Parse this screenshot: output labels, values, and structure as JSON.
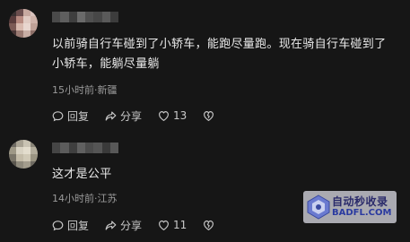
{
  "comments": [
    {
      "text": "以前骑自行车碰到了小轿车，能跑尽量跑。现在骑自行车碰到了小轿车，能躺尽量躺",
      "meta": "15小时前·新疆",
      "actions": {
        "reply_label": "回复",
        "share_label": "分享",
        "like_count": "13"
      }
    },
    {
      "text": "这才是公平",
      "meta": "14小时前·江苏",
      "actions": {
        "reply_label": "回复",
        "share_label": "分享",
        "like_count": "11"
      }
    }
  ],
  "watermark": {
    "title": "自动秒收录",
    "domain": "BADFL.COM"
  },
  "icons": {
    "reply": "reply-bubble-icon",
    "share": "share-arrow-icon",
    "like": "heart-icon",
    "dislike": "broken-heart-icon"
  }
}
